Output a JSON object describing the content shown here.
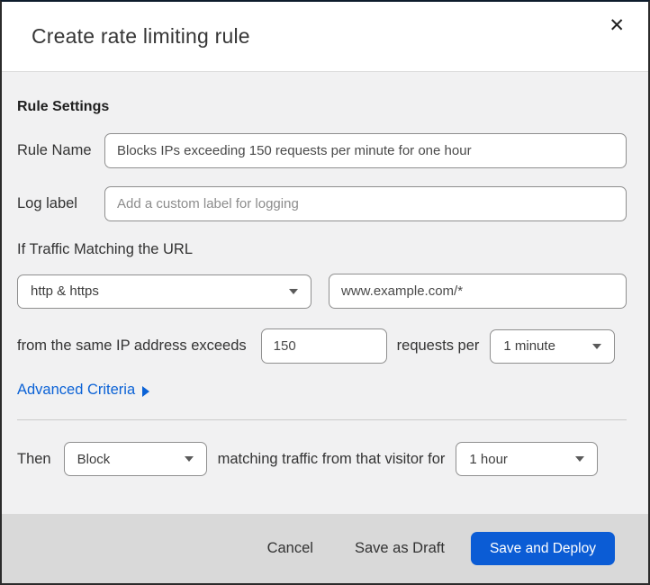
{
  "dialog": {
    "title": "Create rate limiting rule",
    "close_icon": "✕"
  },
  "rule_settings": {
    "heading": "Rule Settings",
    "rule_name_label": "Rule Name",
    "rule_name_value": "Blocks IPs exceeding 150 requests per minute for one hour",
    "log_label_label": "Log label",
    "log_label_placeholder": "Add a custom label for logging"
  },
  "match": {
    "intro_text": "If Traffic Matching the URL",
    "scheme_selected": "http & https",
    "url_value": "www.example.com/*",
    "threshold_prefix": "from the same IP address exceeds",
    "threshold_value": "150",
    "threshold_unit_text": "requests per",
    "period_selected": "1 minute",
    "advanced_link_label": "Advanced Criteria"
  },
  "action": {
    "then_label": "Then",
    "action_selected": "Block",
    "middle_text": "matching traffic from that visitor for",
    "duration_selected": "1 hour"
  },
  "footer": {
    "cancel_label": "Cancel",
    "save_draft_label": "Save as Draft",
    "save_deploy_label": "Save and Deploy"
  },
  "colors": {
    "primary_blue": "#0b5cd5",
    "link_blue": "#0b62d6",
    "body_bg": "#f1f1f2",
    "footer_bg": "#d9d9d9"
  }
}
